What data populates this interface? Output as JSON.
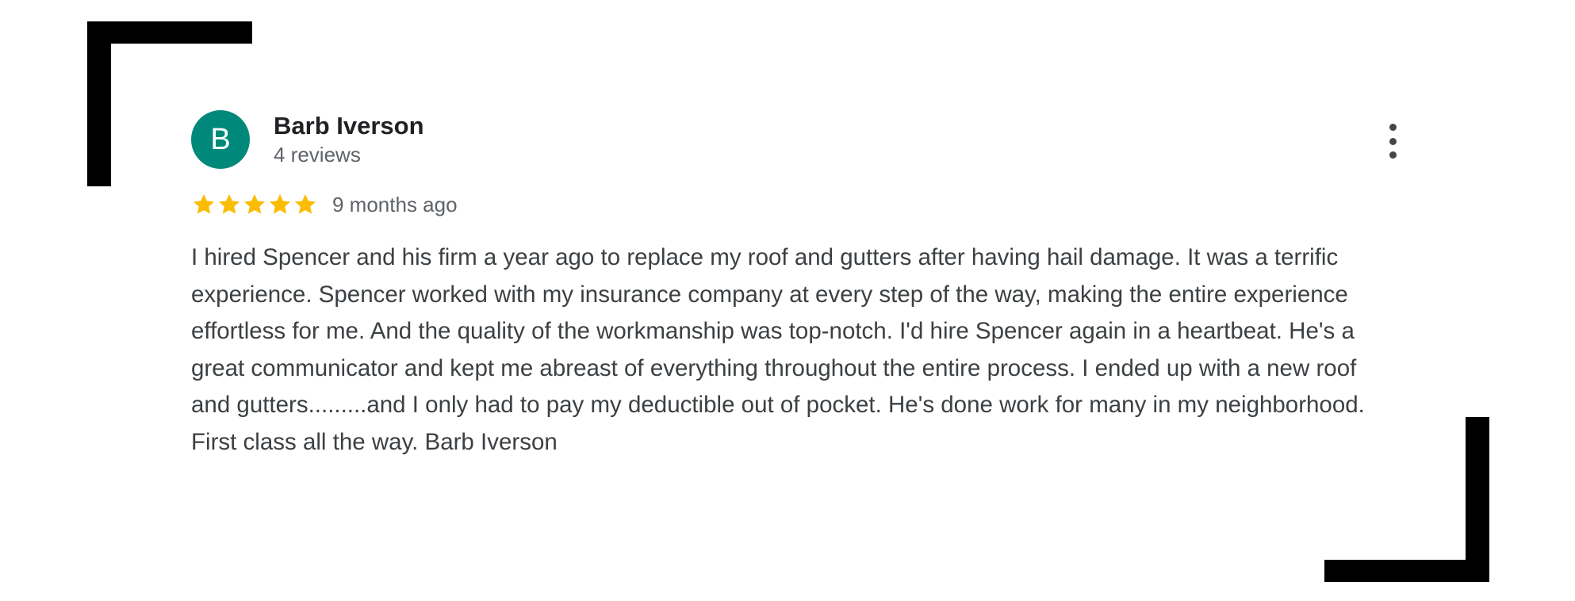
{
  "review": {
    "author": {
      "initial": "B",
      "name": "Barb Iverson",
      "review_count": "4 reviews",
      "avatar_color": "#00897b"
    },
    "rating": {
      "stars": 5,
      "max_stars": 5,
      "star_color": "#fbbc04"
    },
    "time_ago": "9 months ago",
    "text": "I hired Spencer and his firm a year ago to replace my roof and gutters after having hail damage. It was a terrific experience. Spencer worked with my insurance company at every step of the way, making the entire experience effortless for me. And the quality of the workmanship was top-notch. I'd hire Spencer again in a heartbeat. He's a great communicator and kept me abreast of everything throughout the entire process. I ended up with a new roof and gutters.........and I only had to pay my deductible out of pocket. He's done work for many in my neighborhood. First class all the way. Barb Iverson",
    "menu_icon": "more-vert-icon"
  }
}
